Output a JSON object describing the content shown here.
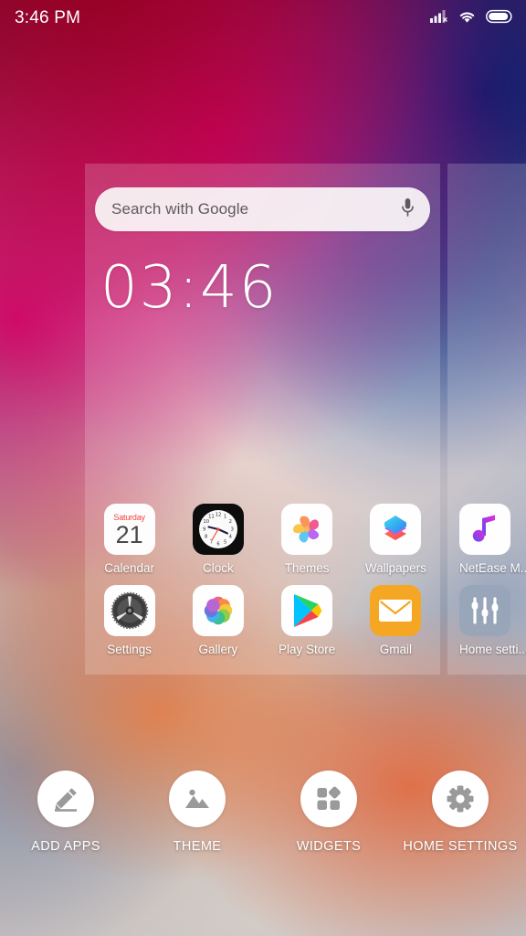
{
  "status_bar": {
    "time": "3:46 PM",
    "icons": [
      "signal-bars-no-sim-icon",
      "wifi-icon",
      "battery-icon"
    ]
  },
  "search_widget": {
    "placeholder": "Search with Google",
    "mic_icon": "microphone-icon"
  },
  "clock_widget": {
    "time": "03:46"
  },
  "apps": [
    {
      "label": "Calendar",
      "icon": "calendar-icon",
      "day_of_week": "Saturday",
      "day": "21"
    },
    {
      "label": "Clock",
      "icon": "clock-icon"
    },
    {
      "label": "Themes",
      "icon": "themes-icon"
    },
    {
      "label": "Wallpapers",
      "icon": "wallpapers-icon"
    },
    {
      "label": "Settings",
      "icon": "settings-icon"
    },
    {
      "label": "Gallery",
      "icon": "gallery-icon"
    },
    {
      "label": "Play Store",
      "icon": "play-store-icon"
    },
    {
      "label": "Gmail",
      "icon": "gmail-icon"
    }
  ],
  "next_page_apps": [
    {
      "label": "NetEase M...",
      "icon": "netease-music-icon"
    },
    {
      "label": "Home setti...",
      "icon": "home-settings-app-icon"
    }
  ],
  "action_bar": [
    {
      "label": "ADD APPS",
      "icon": "pencil-edit-icon"
    },
    {
      "label": "THEME",
      "icon": "image-mountain-icon"
    },
    {
      "label": "WIDGETS",
      "icon": "widgets-squares-icon"
    },
    {
      "label": "HOME SETTINGS",
      "icon": "gear-icon"
    }
  ],
  "colors": {
    "calendar_red": "#f4433a",
    "gmail_orange": "#f5a623",
    "clock_second_hand": "#ff3b30",
    "accent_white": "#ffffff"
  }
}
